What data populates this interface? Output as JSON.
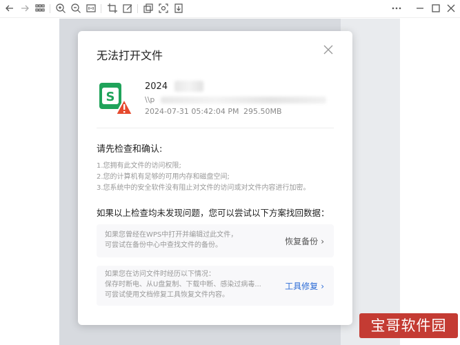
{
  "toolbar": {
    "left_icons": [
      "back-icon",
      "forward-icon",
      "grid-view-icon",
      "zoom-in-icon",
      "zoom-out-icon",
      "fit-page-icon",
      "crop-icon",
      "edit-icon",
      "copy-icon",
      "scan-icon",
      "download-icon"
    ],
    "right_icons": [
      "more-icon",
      "minimize-icon",
      "maximize-icon",
      "close-icon"
    ]
  },
  "dialog": {
    "title": "无法打开文件",
    "file": {
      "name_prefix": "2024",
      "path_prefix": "\\\\p",
      "date": "2024-07-31  05:42:04 PM",
      "size": "295.50MB",
      "icon_letter": "S"
    },
    "check": {
      "title": "请先检查和确认:",
      "items": [
        "1.您拥有此文件的访问权限;",
        "2.您的计算机有足够的可用内存和磁盘空间;",
        "3.您系统中的安全软件没有阻止对文件的访问或对文件内容进行加密。"
      ]
    },
    "try_title": "如果以上检查均未发现问题，您可以尝试以下方案找回数据：",
    "options": [
      {
        "lines": [
          "如果您曾经在WPS中打开并编辑过此文件，",
          "可尝试在备份中心中查找文件的备份。"
        ],
        "link": "恢复备份",
        "link_color": "#555555"
      },
      {
        "lines": [
          "如果您在访问文件时经历以下情况：",
          "保存时断电、从U盘复制、下载中断、感染过病毒...",
          "可尝试使用文档修复工具恢复文件内容。"
        ],
        "link": "工具修复",
        "link_color": "#2b6bd6"
      }
    ]
  },
  "watermark": "宝哥软件园",
  "colors": {
    "wps_green": "#1fa35a",
    "warning_red": "#e64a2e",
    "link_blue": "#2b6bd6",
    "watermark_red": "#c43b33"
  }
}
